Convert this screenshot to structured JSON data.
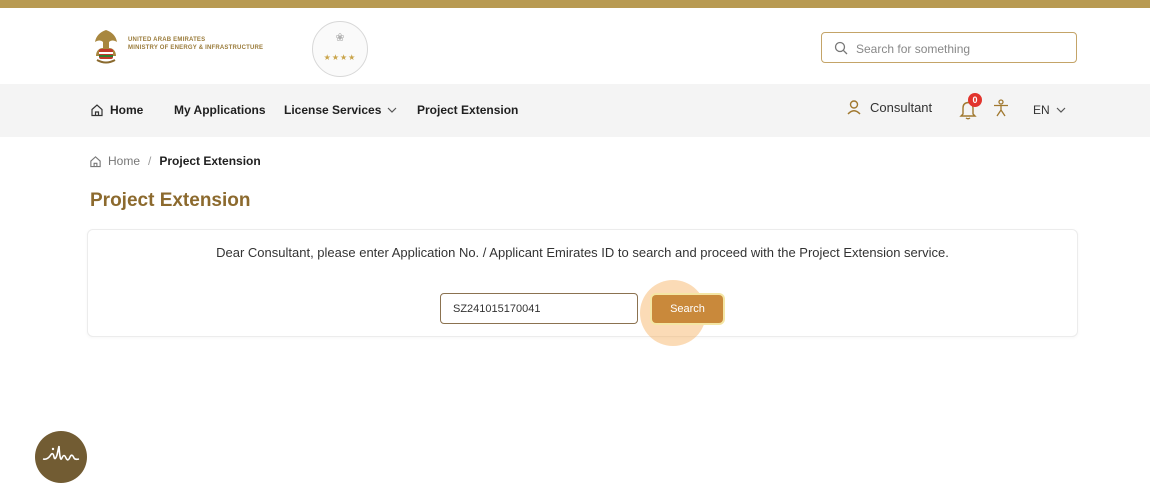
{
  "header": {
    "ministry_line1": "UNITED ARAB EMIRATES",
    "ministry_line2": "MINISTRY OF ENERGY & INFRASTRUCTURE",
    "badge_stars": "★★★★",
    "search_placeholder": "Search for something"
  },
  "nav": {
    "home": "Home",
    "my_applications": "My Applications",
    "license_services": "License Services",
    "project_extension": "Project Extension",
    "user": "Consultant",
    "notification_count": "0",
    "language": "EN"
  },
  "breadcrumb": {
    "home": "Home",
    "separator": "/",
    "current": "Project Extension"
  },
  "page_title": "Project Extension",
  "form": {
    "instruction": "Dear Consultant, please enter Application No. / Applicant Emirates ID to search and proceed with the Project Extension service.",
    "application_value": "SZ241015170041",
    "search_label": "Search"
  },
  "colors": {
    "brand_gold": "#b89a52",
    "title_brown": "#8c6a2e",
    "button_orange": "#c9893b",
    "badge_red": "#e2342d"
  }
}
